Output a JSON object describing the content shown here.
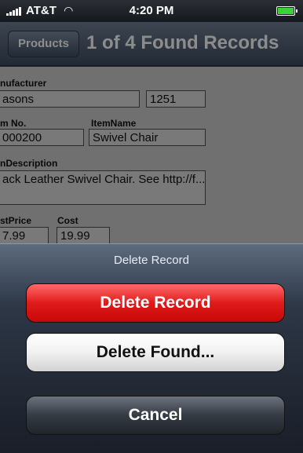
{
  "status_bar": {
    "carrier": "AT&T",
    "time": "4:20 PM"
  },
  "nav": {
    "back_label": "Products",
    "title": "1 of 4 Found Records"
  },
  "form": {
    "manufacturer_label": "nufacturer",
    "manufacturer_value": "asons",
    "manufacturer_code": "1251",
    "item_no_label": "m No.",
    "item_no_value": "000200",
    "item_name_label": "ItemName",
    "item_name_value": "Swivel Chair",
    "description_label": "nDescription",
    "description_value": "ack Leather Swivel Chair. See http://f...",
    "list_price_label": "stPrice",
    "list_price_value": "7.99",
    "cost_label": "Cost",
    "cost_value": "19.99"
  },
  "action_sheet": {
    "title": "Delete Record",
    "delete_record_label": "Delete Record",
    "delete_found_label": "Delete Found...",
    "cancel_label": "Cancel"
  }
}
